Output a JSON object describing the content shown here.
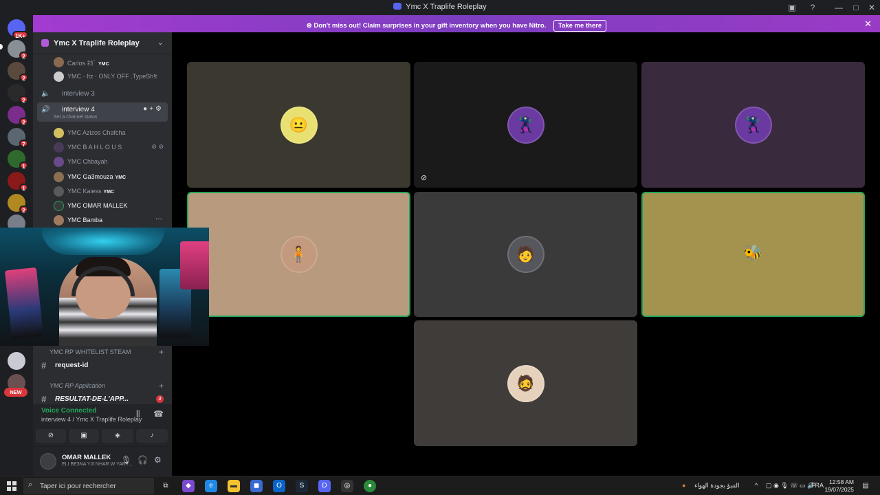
{
  "window": {
    "title": "Ymc X Traplife Roleplay",
    "minimize": "—",
    "maximize": "□",
    "close": "✕"
  },
  "servers": {
    "home_badge": "1K+",
    "badges": [
      "2",
      "2",
      "2",
      "2",
      "7",
      "1",
      "1",
      "2"
    ],
    "new_label": "NEW"
  },
  "banner": {
    "message": "Don't miss out! Claim surprises in your gift inventory when you have Nitro.",
    "button": "Take me there",
    "close": "✕"
  },
  "guild": {
    "name": "Ymc X Traplife Roleplay"
  },
  "members_top": [
    {
      "name": "Carlos ﾈｶﾞ",
      "tag": "YMC"
    },
    {
      "name": "YMC · Itz · ONLY OFF .TypeSh!t",
      "tag": ""
    }
  ],
  "voice_channels": {
    "interview3": "interview 3",
    "interview4": "interview 4",
    "status_placeholder": "Set a channel status"
  },
  "voice_members": [
    {
      "prefix": "YMC",
      "name": "Azizos Chafcha",
      "tag": "",
      "bright": false
    },
    {
      "prefix": "YMC",
      "name": "B A H L O U S",
      "tag": "",
      "bright": false
    },
    {
      "prefix": "YMC",
      "name": "Chbayah",
      "tag": "",
      "bright": false
    },
    {
      "prefix": "YMC",
      "name": "Ga3mouza",
      "tag": "YMC",
      "bright": true
    },
    {
      "prefix": "YMC",
      "name": "Kaiess",
      "tag": "YMC",
      "bright": false
    },
    {
      "prefix": "YMC",
      "name": "OMAR MALLEK",
      "tag": "",
      "bright": true
    },
    {
      "prefix": "YMC",
      "name": "Bamba",
      "tag": "",
      "bright": true
    }
  ],
  "categories": [
    {
      "label": "YMC RP WHITELIST STEAM",
      "channel": "request-id",
      "count": ""
    },
    {
      "label": "YMC RP Application",
      "channel": "RESULTAT-DE-L'APP...",
      "count": "3"
    }
  ],
  "voice_status": {
    "title": "Voice Connected",
    "subtitle": "interview 4 / Ymc X Traplife Roleplay"
  },
  "user": {
    "name": "OMAR MALLEK",
    "status": "ELI BE3NA YJI NHAR W YART..."
  },
  "tiles": [
    {
      "name": "tile-1",
      "avatar": "😐",
      "color": "#3a382f"
    },
    {
      "name": "tile-bahlous",
      "avatar": "🦹",
      "color": "#1a1a1a"
    },
    {
      "name": "tile-chbayah",
      "avatar": "🦹",
      "color": "#3a2a3e"
    },
    {
      "name": "tile-4",
      "avatar": "🧍",
      "color": "#b89a7e"
    },
    {
      "name": "tile-5",
      "avatar": "🧑",
      "color": "#3a3a3a"
    },
    {
      "name": "tile-6",
      "avatar": "🐝",
      "color": "#a3934e"
    },
    {
      "name": "tile-7",
      "avatar": "🧔",
      "color": "#403c3a"
    }
  ],
  "taskbar": {
    "search_placeholder": "Taper ici pour rechercher",
    "weather": "التنبؤ بجودة الهواء",
    "lang": "FRA",
    "time": "12:58 AM",
    "date": "19/07/2025"
  }
}
